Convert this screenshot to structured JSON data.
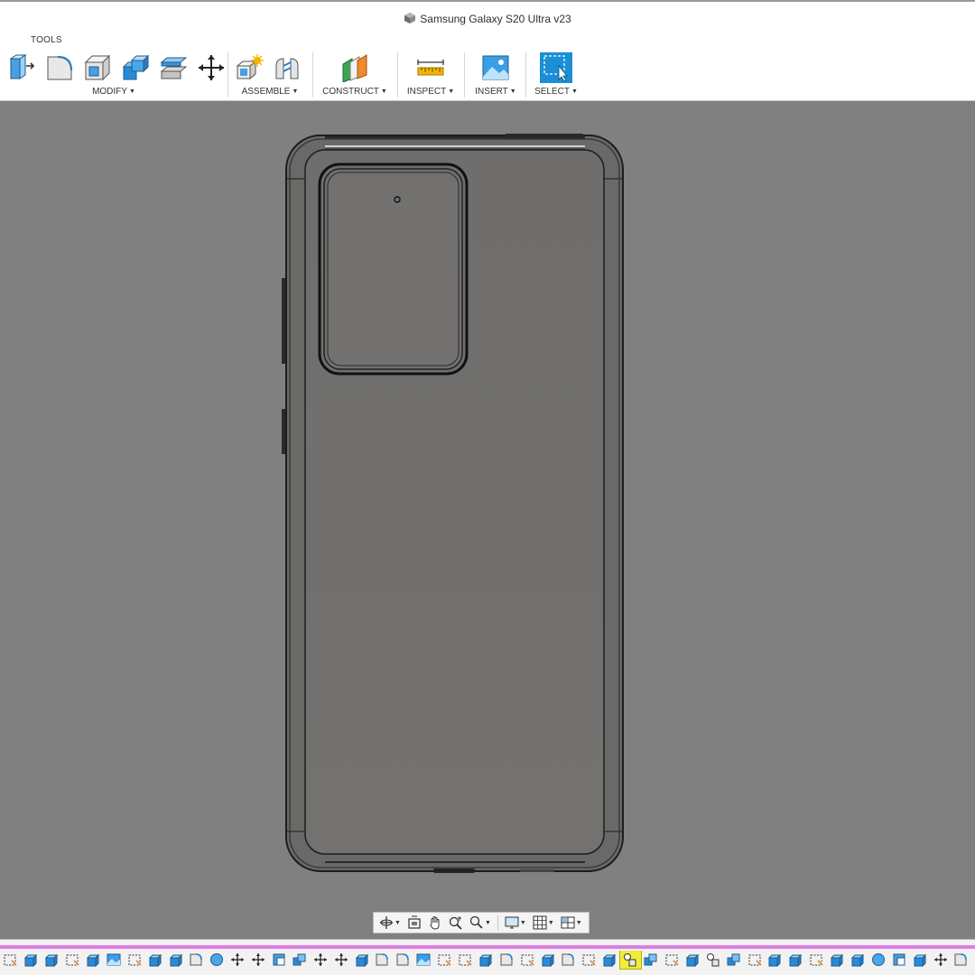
{
  "window": {
    "title": "Samsung Galaxy S20 Ultra v23",
    "doc_icon": "cube-icon"
  },
  "toolbar": {
    "workspace": "TOOLS",
    "groups": [
      {
        "label": "MODIFY",
        "tools": [
          "press-pull-icon",
          "fillet-icon",
          "shell-icon",
          "combine-icon",
          "offset-face-icon",
          "move-icon"
        ]
      },
      {
        "label": "ASSEMBLE",
        "tools": [
          "new-component-icon",
          "joint-icon"
        ]
      },
      {
        "label": "CONSTRUCT",
        "tools": [
          "offset-plane-icon"
        ]
      },
      {
        "label": "INSPECT",
        "tools": [
          "measure-icon"
        ]
      },
      {
        "label": "INSERT",
        "tools": [
          "insert-canvas-icon"
        ]
      },
      {
        "label": "SELECT",
        "tools": [
          "window-select-icon"
        ]
      }
    ]
  },
  "navbar": {
    "items": [
      "orbit-icon",
      "look-at-icon",
      "pan-icon",
      "zoom-window-icon",
      "zoom-icon",
      "display-settings-icon",
      "grid-icon",
      "viewports-icon"
    ]
  },
  "timeline": {
    "active_index": 30,
    "items": [
      "sketch-icon",
      "extrude-icon",
      "extrude-icon",
      "sketch-icon",
      "extrude-icon",
      "canvas-icon",
      "sketch-icon",
      "extrude-icon",
      "extrude-icon",
      "fillet-icon",
      "sphere-icon",
      "move-icon",
      "move-icon",
      "split-icon",
      "combine-icon",
      "move-icon",
      "move-icon",
      "extrude-icon",
      "fillet-icon",
      "fillet-icon",
      "canvas-icon",
      "sketch-icon",
      "sketch-icon",
      "extrude-icon",
      "fillet-icon",
      "sketch-icon",
      "extrude-icon",
      "fillet-icon",
      "sketch-icon",
      "extrude-icon",
      "joint-icon",
      "combine-icon",
      "sketch-icon",
      "extrude-icon",
      "joint-icon",
      "combine-icon",
      "sketch-icon",
      "extrude-icon",
      "extrude-icon",
      "sketch-icon",
      "extrude-icon",
      "extrude-icon",
      "sphere-icon",
      "split-icon",
      "extrude-icon",
      "move-icon",
      "fillet-icon",
      "sketch-icon"
    ]
  },
  "colors": {
    "canvas_bg": "#808080",
    "phone_body": "#716f6d",
    "timeline_bar": "#e07be6",
    "active_feature": "#f0ec3a",
    "accent_blue": "#1a8fd6"
  }
}
